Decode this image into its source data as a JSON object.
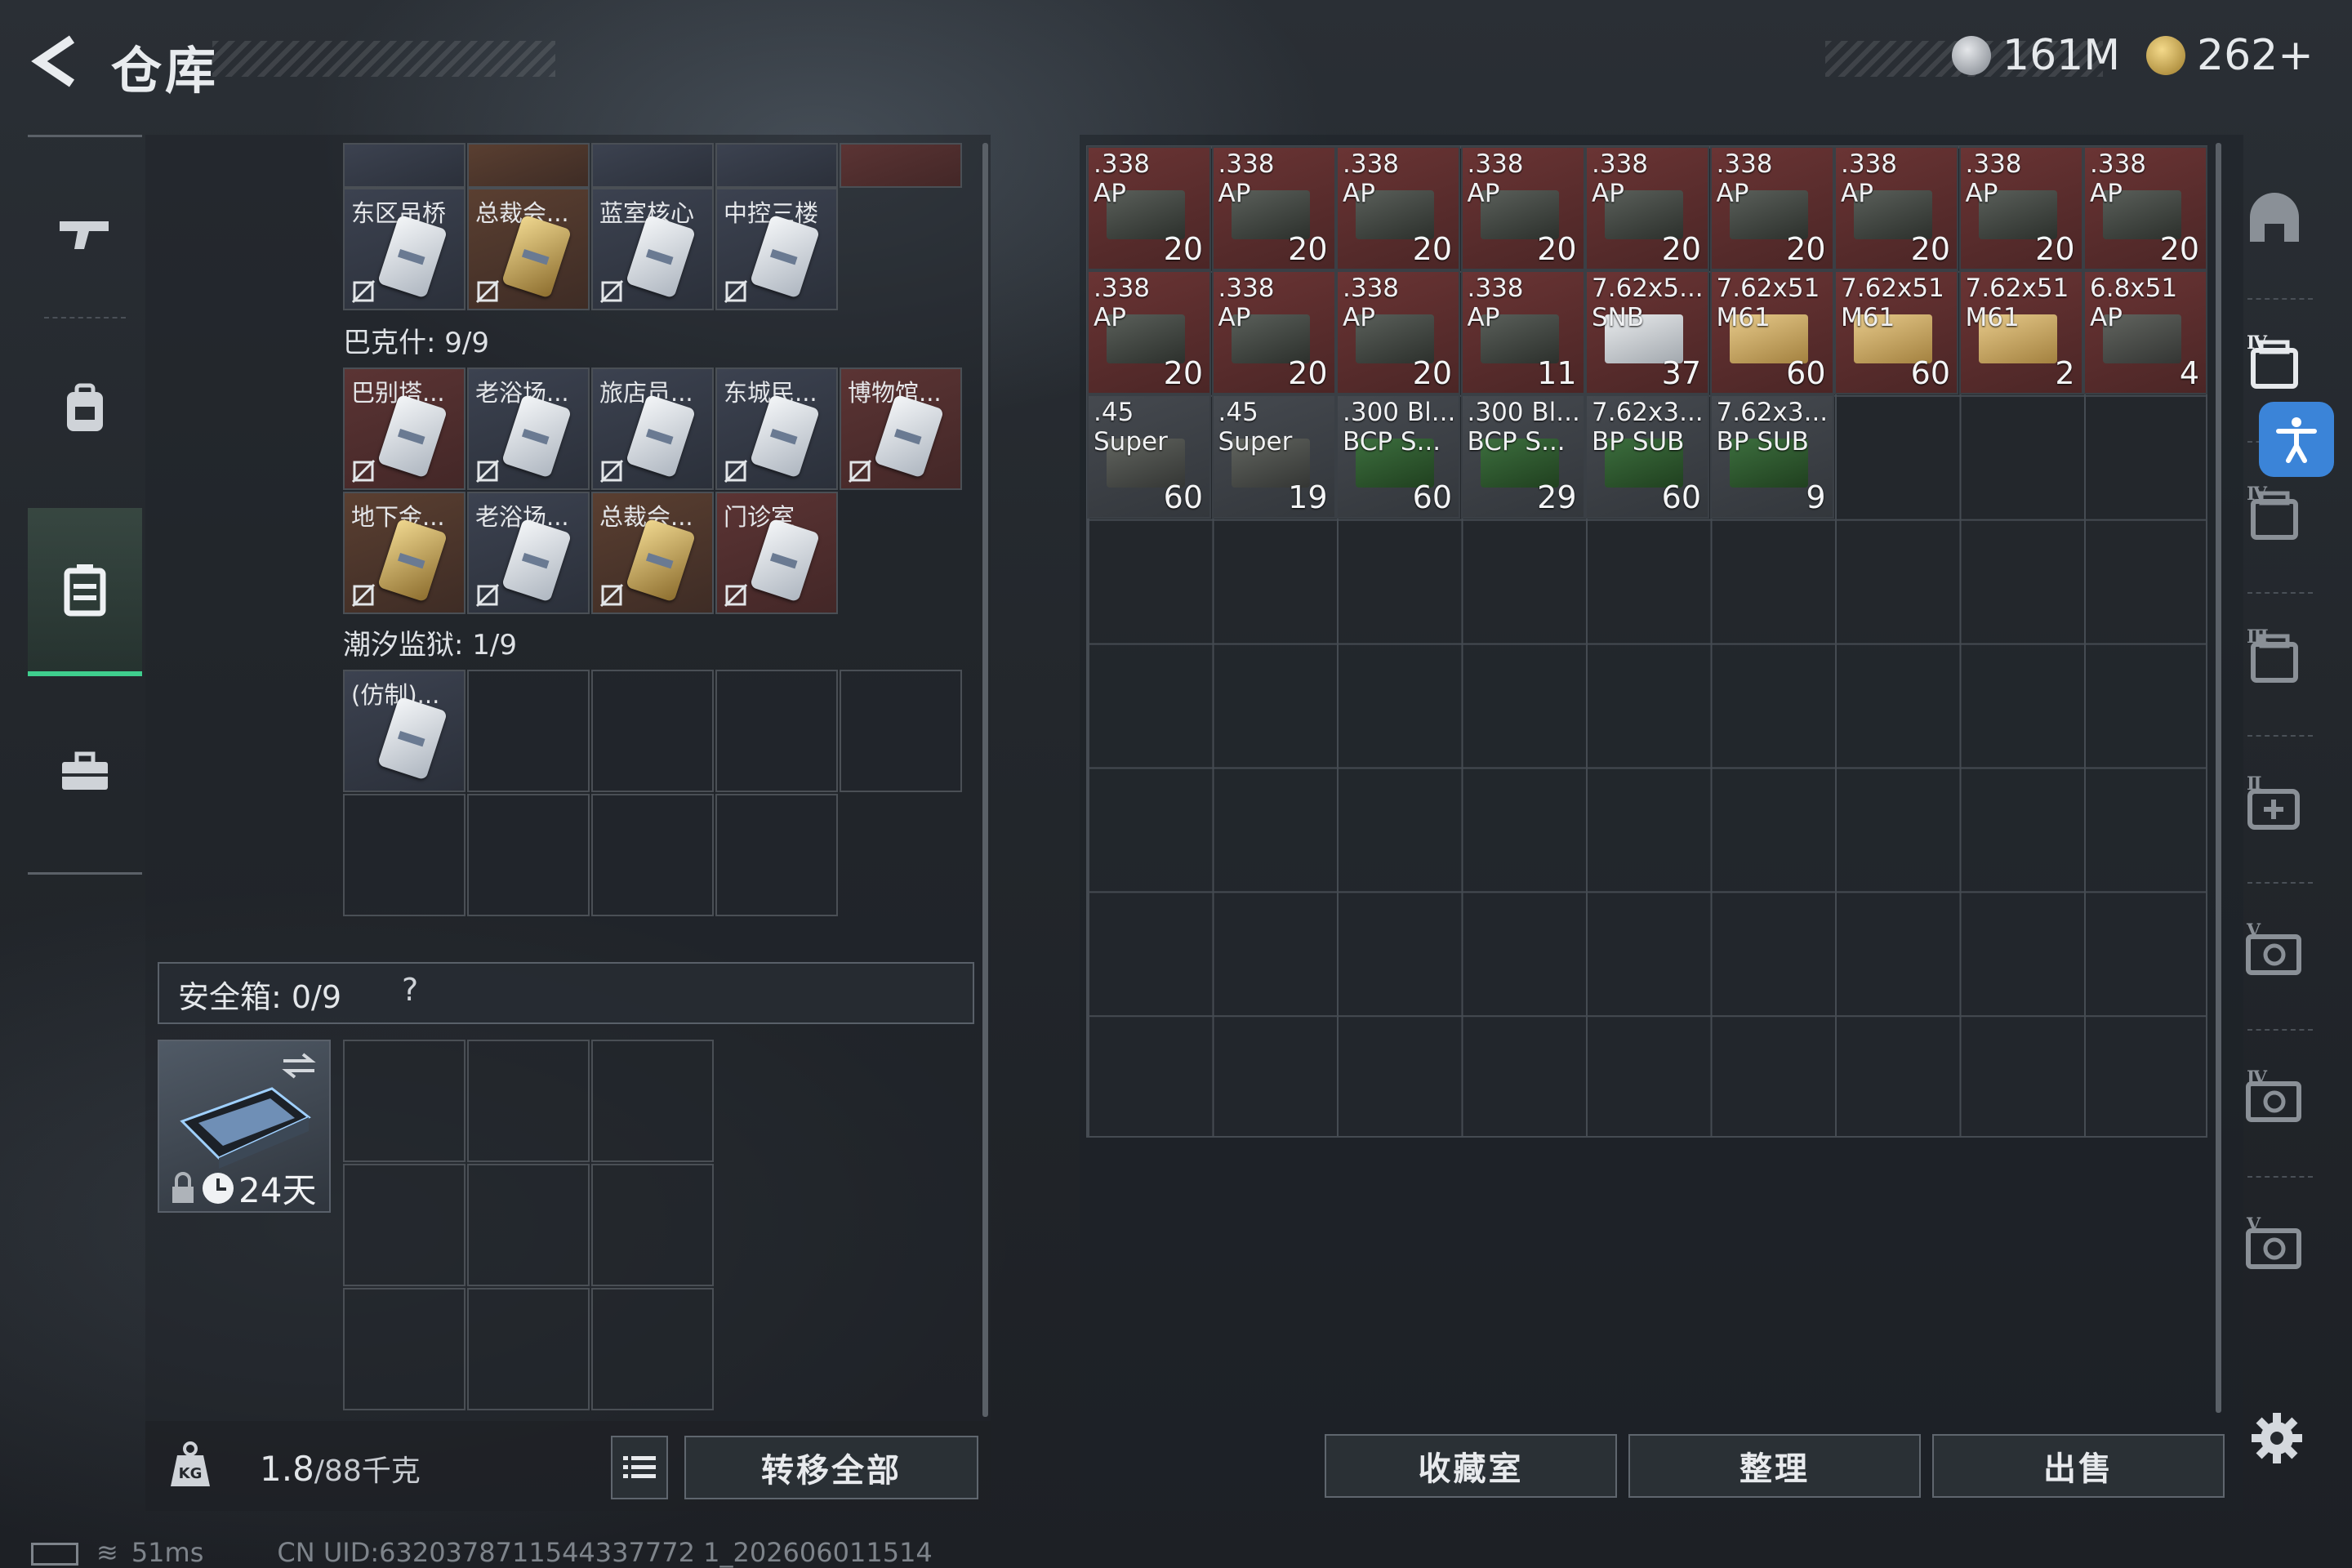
{
  "header": {
    "title": "仓库"
  },
  "currencies": [
    {
      "icon": "silver-coin-icon",
      "value": "161M"
    },
    {
      "icon": "gold-triangle-coin-icon",
      "value": "262+"
    }
  ],
  "left_rail": [
    "weapon-icon",
    "backpack-icon",
    "container-icon",
    "toolbox-icon"
  ],
  "keys": {
    "top_partial_row": [
      "",
      "",
      "",
      "",
      ""
    ],
    "row_a": [
      {
        "name": "东区吊桥",
        "gold": false,
        "red": false
      },
      {
        "name": "总裁会...",
        "gold": true,
        "red": false
      },
      {
        "name": "蓝室核心",
        "gold": false,
        "red": false
      },
      {
        "name": "中控三楼",
        "gold": false,
        "red": false
      }
    ],
    "section_b_label": "巴克什: 9/9",
    "row_b1": [
      {
        "name": "巴别塔...",
        "gold": false,
        "red": true
      },
      {
        "name": "老浴场...",
        "gold": false,
        "red": false
      },
      {
        "name": "旅店员...",
        "gold": false,
        "red": false
      },
      {
        "name": "东城民...",
        "gold": false,
        "red": false
      },
      {
        "name": "博物馆...",
        "gold": false,
        "red": true
      }
    ],
    "row_b2": [
      {
        "name": "地下金...",
        "gold": true,
        "red": false
      },
      {
        "name": "老浴场...",
        "gold": false,
        "red": false
      },
      {
        "name": "总裁会...",
        "gold": true,
        "red": false
      },
      {
        "name": "门诊室",
        "gold": false,
        "red": true
      }
    ],
    "section_c_label": "潮汐监狱: 1/9",
    "row_c1": [
      {
        "name": "(仿制)..."
      }
    ]
  },
  "safe_box": {
    "label": "安全箱: 0/9",
    "help": "?",
    "case_days": "24天"
  },
  "bottom_left": {
    "weight_current": "1.8",
    "weight_max": "/88千克",
    "transfer_all": "转移全部"
  },
  "stash_items": [
    {
      "name": ".338\nAP",
      "count": "20",
      "bg": "red",
      "box": "mil"
    },
    {
      "name": ".338\nAP",
      "count": "20",
      "bg": "red",
      "box": "mil"
    },
    {
      "name": ".338\nAP",
      "count": "20",
      "bg": "red",
      "box": "mil"
    },
    {
      "name": ".338\nAP",
      "count": "20",
      "bg": "red",
      "box": "mil"
    },
    {
      "name": ".338\nAP",
      "count": "20",
      "bg": "red",
      "box": "mil"
    },
    {
      "name": ".338\nAP",
      "count": "20",
      "bg": "red",
      "box": "mil"
    },
    {
      "name": ".338\nAP",
      "count": "20",
      "bg": "red",
      "box": "mil"
    },
    {
      "name": ".338\nAP",
      "count": "20",
      "bg": "red",
      "box": "mil"
    },
    {
      "name": ".338\nAP",
      "count": "20",
      "bg": "red",
      "box": "mil"
    },
    {
      "name": ".338\nAP",
      "count": "20",
      "bg": "red",
      "box": "mil"
    },
    {
      "name": ".338\nAP",
      "count": "20",
      "bg": "red",
      "box": "mil"
    },
    {
      "name": ".338\nAP",
      "count": "20",
      "bg": "red",
      "box": "mil"
    },
    {
      "name": ".338\nAP",
      "count": "11",
      "bg": "red",
      "box": "mil"
    },
    {
      "name": "7.62x5...\nSNB",
      "count": "37",
      "bg": "red",
      "box": "wht"
    },
    {
      "name": "7.62x51\nM61",
      "count": "60",
      "bg": "red",
      "box": "tan"
    },
    {
      "name": "7.62x51\nM61",
      "count": "60",
      "bg": "red",
      "box": "tan"
    },
    {
      "name": "7.62x51\nM61",
      "count": "2",
      "bg": "red",
      "box": "tan"
    },
    {
      "name": "6.8x51\nAP",
      "count": "4",
      "bg": "red",
      "box": "dk"
    },
    {
      "name": ".45\nSuper",
      "count": "60",
      "bg": "gray",
      "box": "dk"
    },
    {
      "name": ".45\nSuper",
      "count": "19",
      "bg": "gray",
      "box": "dk"
    },
    {
      "name": ".300 Bl...\nBCP S...",
      "count": "60",
      "bg": "gray",
      "box": "grn"
    },
    {
      "name": ".300 Bl...\nBCP S...",
      "count": "29",
      "bg": "gray",
      "box": "grn"
    },
    {
      "name": "7.62x3...\nBP SUB",
      "count": "60",
      "bg": "gray",
      "box": "grn"
    },
    {
      "name": "7.62x3...\nBP SUB",
      "count": "9",
      "bg": "gray",
      "box": "grn"
    }
  ],
  "right_buttons": {
    "collection": "收藏室",
    "sort": "整理",
    "sell": "出售"
  },
  "right_rail": [
    "helmet-icon",
    "backpack-tier-4-icon",
    "backpack-tier-4-icon",
    "armor-tier-3-icon",
    "medkit-tier-2-icon",
    "safe-tier-5-icon",
    "safe-tier-4-icon",
    "safe-tier-5-icon"
  ],
  "status": {
    "ping": "51ms",
    "uid": "CN UID:6320378711544337772 1_202606011514"
  }
}
